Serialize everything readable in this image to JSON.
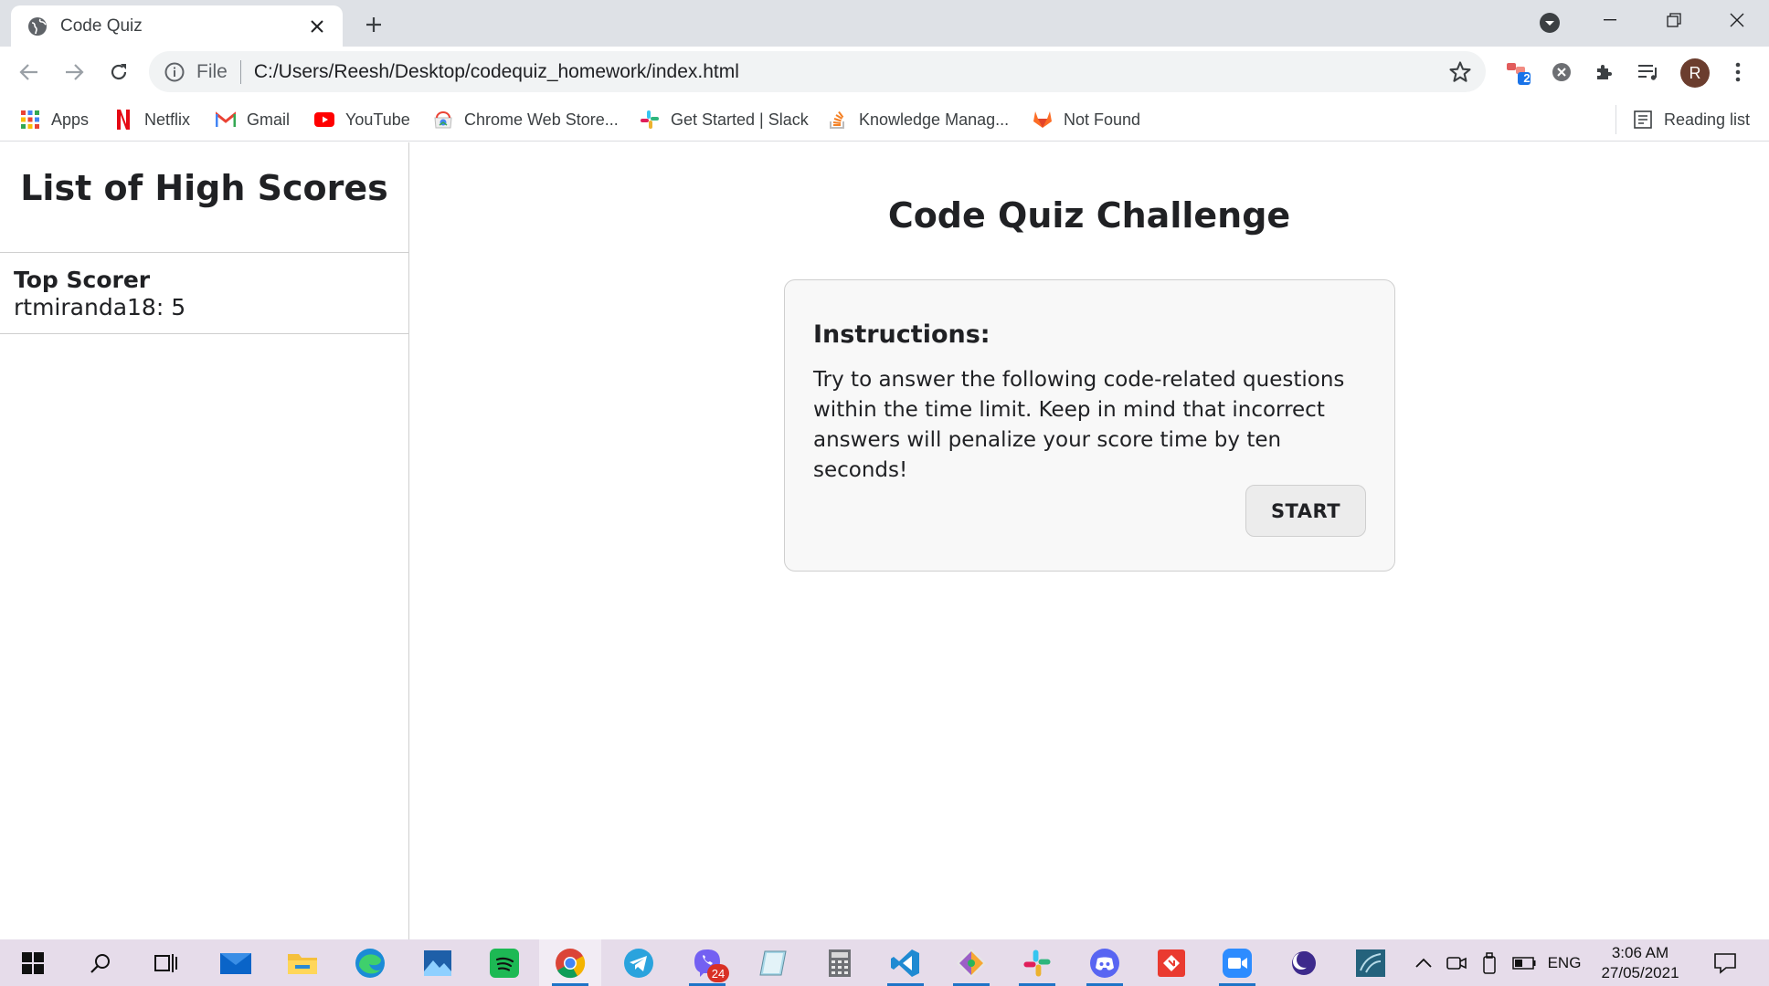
{
  "browser": {
    "tab_title": "Code Quiz",
    "omnibox": {
      "scheme": "File",
      "url": "C:/Users/Reesh/Desktop/codequiz_homework/index.html"
    },
    "extension_badge": "2",
    "avatar_initial": "R",
    "bookmarks": [
      {
        "label": "Apps",
        "icon": "apps-grid-icon"
      },
      {
        "label": "Netflix",
        "icon": "netflix-icon"
      },
      {
        "label": "Gmail",
        "icon": "gmail-icon"
      },
      {
        "label": "YouTube",
        "icon": "youtube-icon"
      },
      {
        "label": "Chrome Web Store...",
        "icon": "chrome-web-store-icon"
      },
      {
        "label": "Get Started | Slack",
        "icon": "slack-icon"
      },
      {
        "label": "Knowledge Manag...",
        "icon": "stack-overflow-icon"
      },
      {
        "label": "Not Found",
        "icon": "gitlab-icon"
      }
    ],
    "reading_list": "Reading list"
  },
  "page": {
    "sidebar": {
      "title": "List of High Scores",
      "top_scorer_label": "Top Scorer",
      "top_scorer_value": "rtmiranda18: 5"
    },
    "main": {
      "title": "Code Quiz Challenge",
      "instructions_heading": "Instructions:",
      "instructions_text": "Try to answer the following code-related questions within the time limit. Keep in mind that incorrect answers will penalize your score time by ten seconds!",
      "start_label": "START"
    }
  },
  "taskbar": {
    "viber_badge": "24",
    "language": "ENG",
    "time": "3:06 AM",
    "date": "27/05/2021"
  }
}
